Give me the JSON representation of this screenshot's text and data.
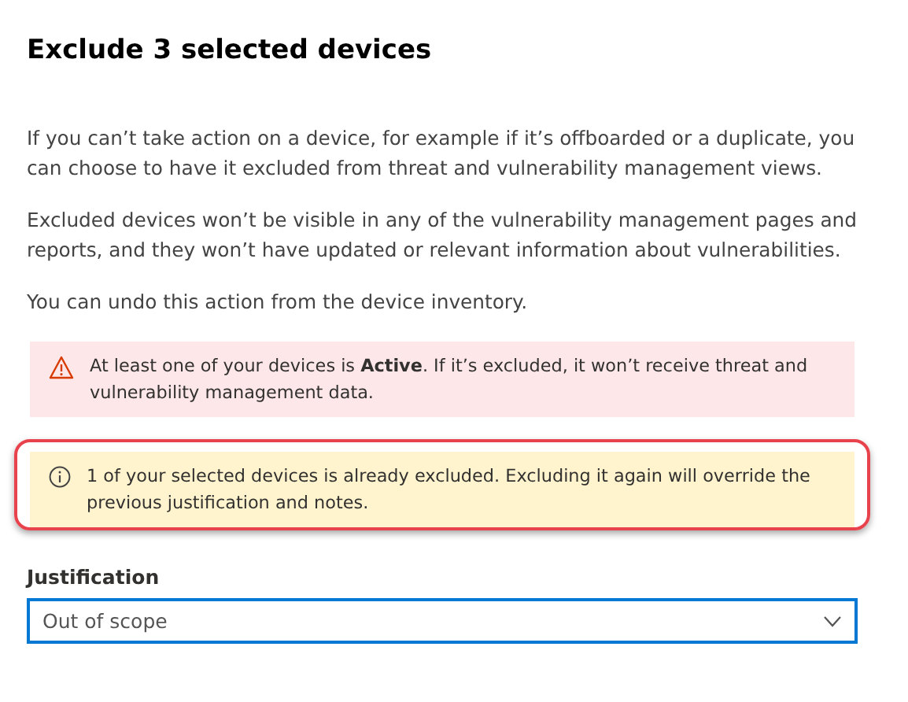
{
  "title": "Exclude 3 selected devices",
  "paragraphs": [
    "If you can’t take action on a device, for example if it’s offboarded or a duplicate, you can choose to have it excluded from threat and vulnerability management views.",
    "Excluded devices won’t be visible in any of the vulnerability management pages and reports, and they won’t have updated or relevant information about vulnerabilities.",
    "You can undo this action from the device inventory."
  ],
  "messages": [
    {
      "kind": "warning",
      "text": "At least one of your devices is **Active**. If it’s excluded, it won’t receive threat and vulnerability management data.",
      "highlighted": false
    },
    {
      "kind": "info",
      "text": "1 of your selected devices is already excluded. Excluding it again will override the previous justification and notes.",
      "highlighted": true
    }
  ],
  "justification": {
    "label": "Justification",
    "value": "Out of scope"
  }
}
